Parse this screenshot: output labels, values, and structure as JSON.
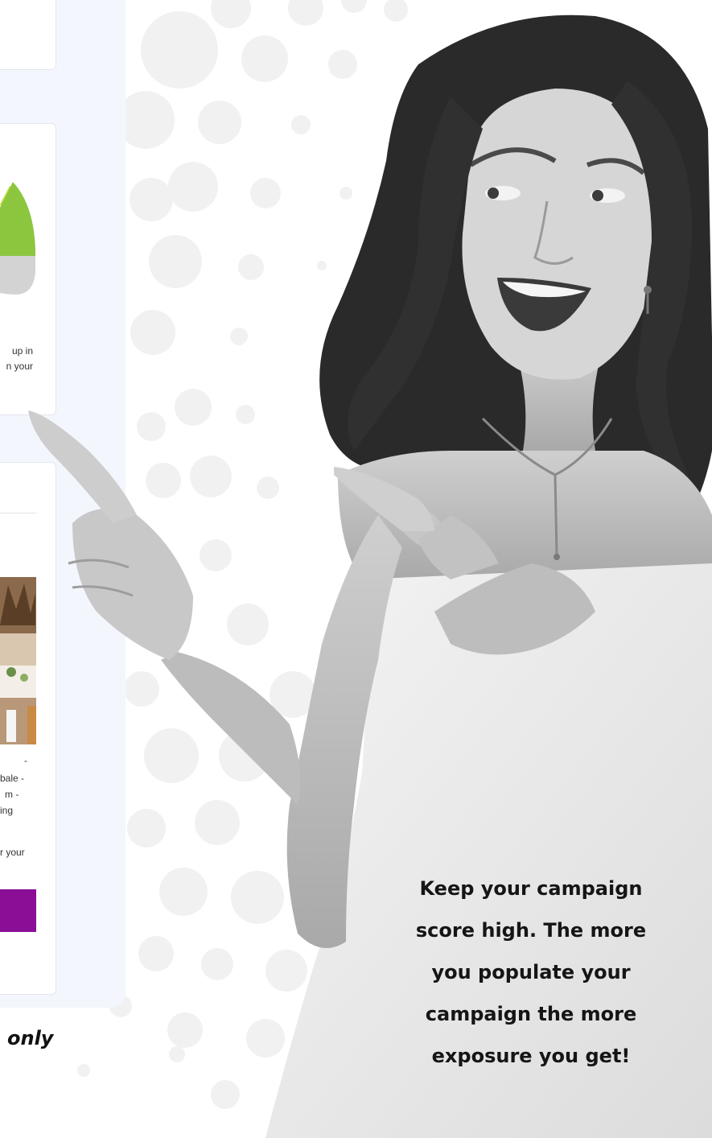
{
  "dashboard_snippets": {
    "card2_lines": [
      "up in",
      "n your"
    ],
    "card3_lines": [
      "-",
      "bale -",
      "m -",
      "ing",
      "r your"
    ]
  },
  "caption": "only",
  "tagline": {
    "lines": [
      "Keep your campaign",
      "score high. The more",
      "you populate your",
      "campaign the more",
      "exposure you get!"
    ]
  },
  "colors": {
    "panel_background": "#f3f6fc",
    "cta_purple": "#8a0f96",
    "gauge_green": "#8cc63f",
    "gauge_lime": "#c5e03a",
    "gauge_grey": "#d3d3d3"
  }
}
